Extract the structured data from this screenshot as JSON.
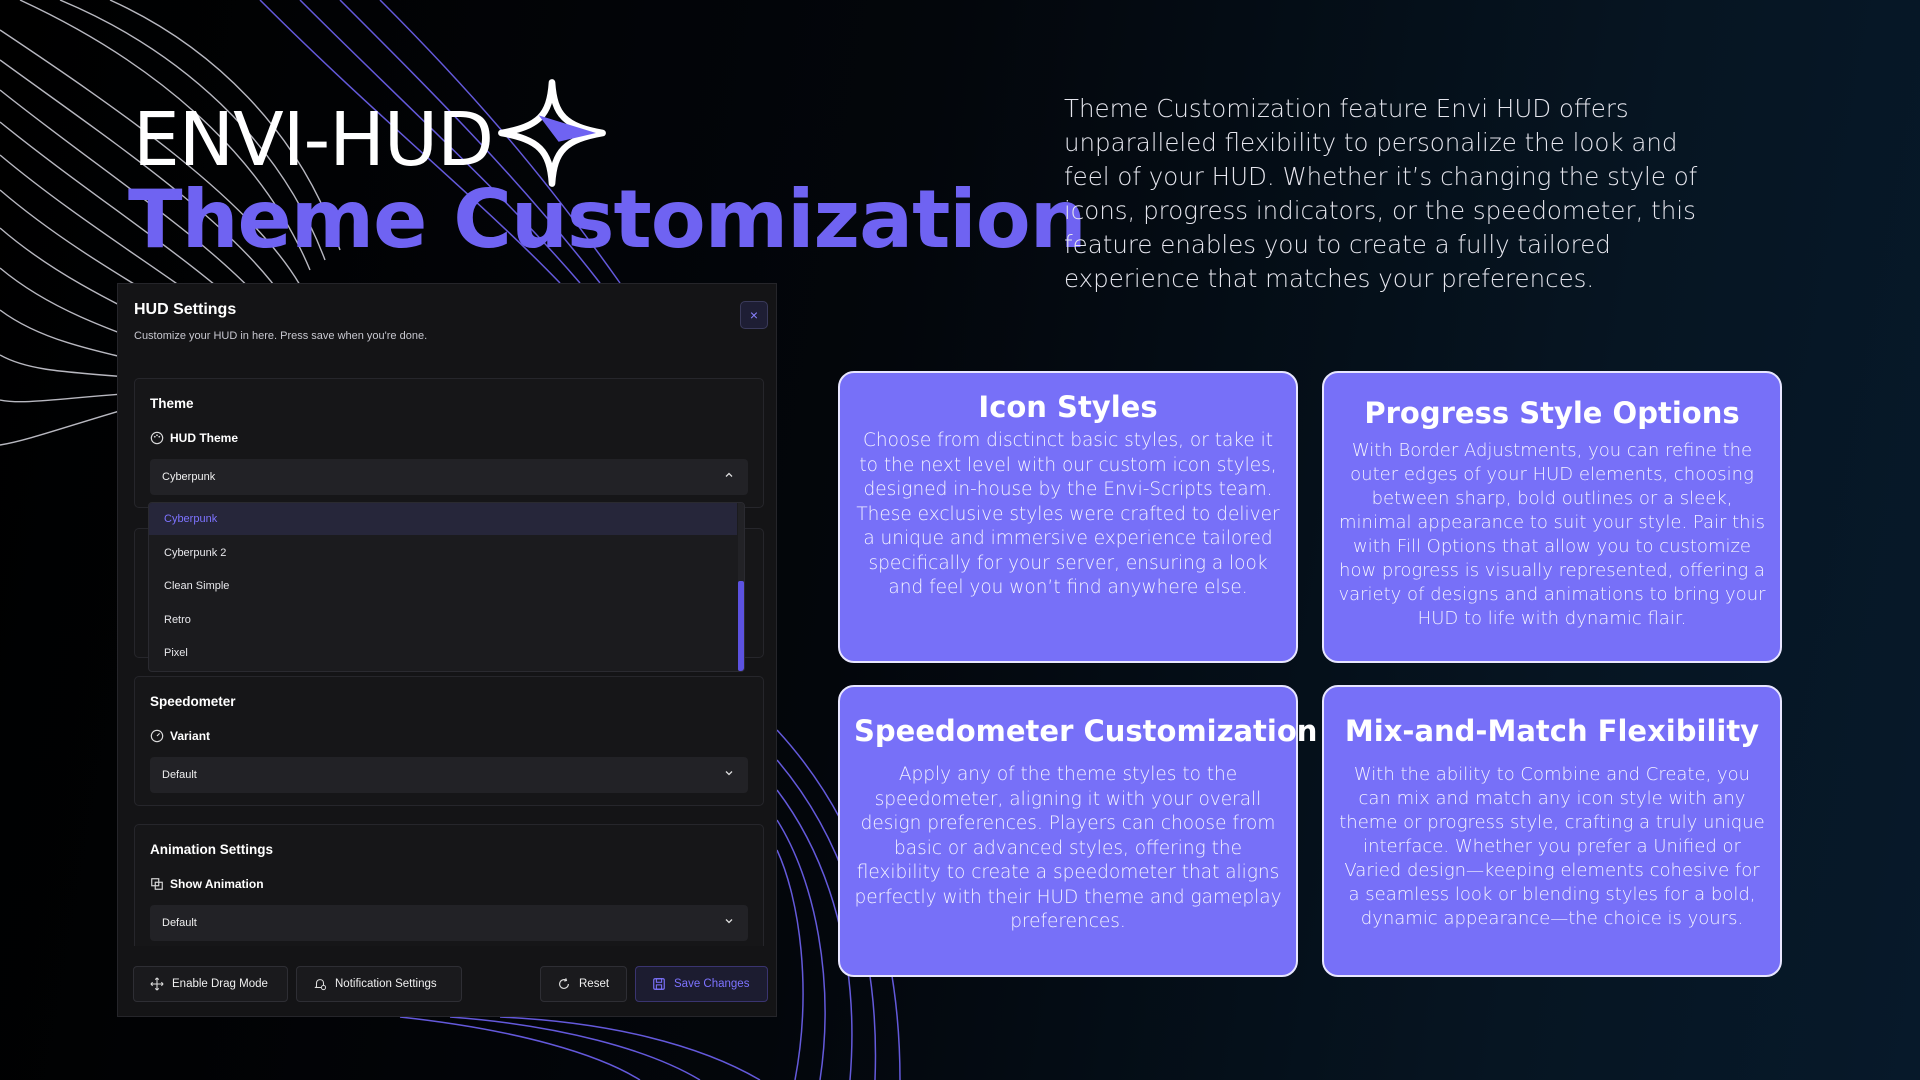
{
  "colors": {
    "accent": "#6f63f2",
    "card_bg": "#7770f8",
    "panel_bg": "#141416",
    "page_bg": "#000000"
  },
  "hero": {
    "brand": "ENVI-HUD",
    "subtitle": "Theme Customization",
    "description": "Theme Customization feature Envi HUD offers unparalleled flexibility to personalize the look and feel of your HUD. Whether it’s changing the style of icons, progress indicators, or the speedometer, this feature enables you to create a fully tailored experience that matches your preferences."
  },
  "panel": {
    "title": "HUD Settings",
    "subtitle": "Customize your HUD in here. Press save when you're done.",
    "close_icon": "×",
    "theme_section": {
      "title": "Theme",
      "field_label": "HUD Theme",
      "selected": "Cyberpunk",
      "options": [
        "Cyberpunk",
        "Cyberpunk 2",
        "Clean Simple",
        "Retro",
        "Pixel"
      ]
    },
    "speedometer_section": {
      "title": "Speedometer",
      "field_label": "Variant",
      "selected": "Default"
    },
    "animation_section": {
      "title": "Animation Settings",
      "field_label": "Show Animation",
      "selected": "Default"
    },
    "footer": {
      "drag_mode": "Enable Drag Mode",
      "notifications": "Notification Settings",
      "reset": "Reset",
      "save": "Save Changes"
    }
  },
  "cards": [
    {
      "title": "Icon Styles",
      "body": "Choose from disctinct basic styles, or take it to the next level with our custom icon styles, designed in-house by the Envi-Scripts team. These exclusive styles were crafted to deliver a unique and immersive experience tailored specifically for your server, ensuring a look and feel you won’t find anywhere else."
    },
    {
      "title": "Progress Style Options",
      "body": "With Border Adjustments, you can refine the outer edges of your HUD elements, choosing between sharp, bold outlines or a sleek, minimal appearance to suit your style. Pair this with Fill Options that allow you to customize how progress is visually represented, offering a variety of designs and animations to bring your HUD to life with dynamic flair."
    },
    {
      "title": "Speedometer Customization",
      "body": "Apply any of the theme styles to the speedometer, aligning it with your overall design preferences. Players can choose from basic or advanced styles, offering the flexibility to create a speedometer that aligns perfectly with their HUD theme and gameplay preferences."
    },
    {
      "title": "Mix-and-Match Flexibility",
      "body": "With the ability to Combine and Create, you can mix and match any icon style with any theme or progress style, crafting a truly unique interface. Whether you prefer a Unified or Varied design—keeping elements cohesive for a seamless look or blending styles for a bold, dynamic appearance—the choice is yours."
    }
  ]
}
